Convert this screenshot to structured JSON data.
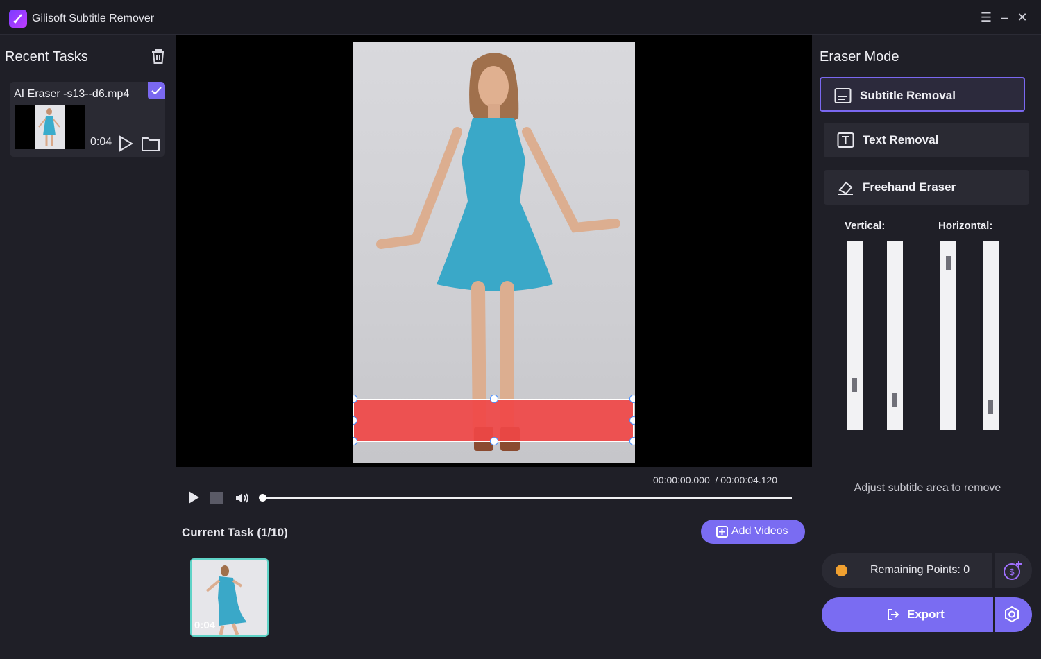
{
  "app": {
    "title": "Gilisoft Subtitle Remover"
  },
  "window": {
    "menu_glyph": "☰",
    "minimize_glyph": "–",
    "close_glyph": "✕"
  },
  "left_panel": {
    "title": "Recent Tasks",
    "task": {
      "name": "AI Eraser -s13--d6.mp4",
      "duration": "0:04",
      "checked": true
    }
  },
  "player": {
    "current_time": "00:00:00.000",
    "total_time": "/ 00:00:04.120",
    "progress": 0.0
  },
  "task_area": {
    "title": "Current Task",
    "count": "(1/10)",
    "add_label": "Add Videos",
    "current_duration": "0:04"
  },
  "right_panel": {
    "title": "Eraser Mode",
    "modes": [
      {
        "label": "Subtitle Removal",
        "icon": "subtitle-icon",
        "active": true
      },
      {
        "label": "Text Removal",
        "icon": "text-icon",
        "active": false
      },
      {
        "label": "Freehand Eraser",
        "icon": "eraser-icon",
        "active": false
      }
    ],
    "vertical_label": "Vertical:",
    "horizontal_label": "Horizontal:",
    "hint": "Adjust subtitle area to remove",
    "points_label": "Remaining Points: 0",
    "export_label": "Export"
  },
  "colors": {
    "accent": "#7a6cf2",
    "selection": "#f04646",
    "thumb_border": "#5fd3c7"
  }
}
